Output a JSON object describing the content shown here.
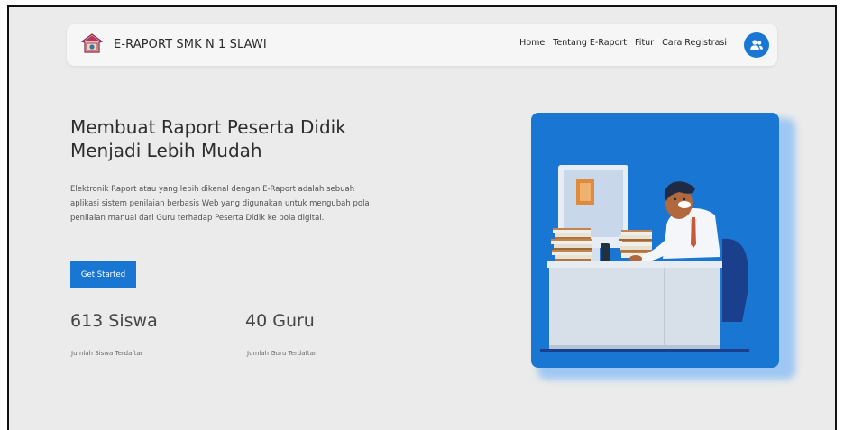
{
  "navbar": {
    "brand": "E-RAPORT SMK N 1 SLAWI",
    "links": [
      "Home",
      "Tentang E-Raport",
      "Fitur",
      "Cara Registrasi"
    ]
  },
  "hero": {
    "title_line1": "Membuat Raport Peserta Didik",
    "title_line2": "Menjadi Lebih Mudah",
    "desc_line1": "Elektronik Raport atau yang lebih dikenal dengan E-Raport adalah sebuah",
    "desc_line2": "aplikasi sistem penilaian berbasis Web yang digunakan untuk mengubah pola",
    "desc_line3": "penilaian manual dari Guru terhadap Peserta Didik ke pola digital.",
    "cta_label": "Get Started"
  },
  "stats": [
    {
      "value": "613 Siswa",
      "label": "Jumlah Siswa Terdaftar"
    },
    {
      "value": "40 Guru",
      "label": "Jumlah Guru Terdaftar"
    }
  ],
  "colors": {
    "primary": "#1976d2",
    "background": "#ebebeb",
    "navbar": "#f6f6f6"
  },
  "icons": {
    "brand": "school-logo-icon",
    "user": "users-icon"
  }
}
